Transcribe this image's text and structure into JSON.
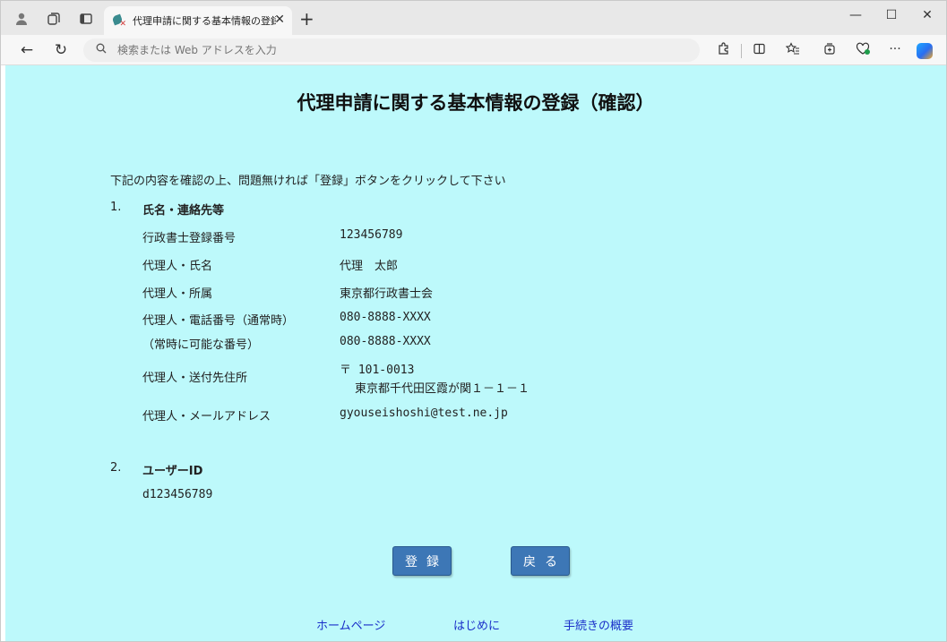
{
  "browser": {
    "tab_title": "代理申請に関する基本情報の登録",
    "address_placeholder": "検索または Web アドレスを入力"
  },
  "page": {
    "title": "代理申請に関する基本情報の登録（確認）",
    "intro": "下記の内容を確認の上、問題無ければ「登録」ボタンをクリックして下さい",
    "section1": {
      "number": "1.",
      "title": "氏名・連絡先等",
      "rows": [
        {
          "label": "行政書士登録番号",
          "value": "123456789"
        },
        {
          "label": "代理人・氏名",
          "value": "代理　太郎"
        },
        {
          "label": "代理人・所属",
          "value": "東京都行政書士会"
        },
        {
          "label": "代理人・電話番号（通常時）",
          "value": "080-8888-XXXX"
        },
        {
          "label": "（常時に可能な番号）",
          "value": "080-8888-XXXX"
        },
        {
          "label": "代理人・送付先住所",
          "value": "〒 101-0013",
          "value2": "東京都千代田区霞が関１－１－１"
        },
        {
          "label": "代理人・メールアドレス",
          "value": "gyouseishoshi@test.ne.jp"
        }
      ]
    },
    "section2": {
      "number": "2.",
      "title": "ユーザーID",
      "value": "d123456789"
    },
    "buttons": {
      "register": "登録",
      "back": "戻る"
    },
    "footer": {
      "home": "ホームページ",
      "intro": "はじめに",
      "overview": "手続きの概要"
    }
  }
}
